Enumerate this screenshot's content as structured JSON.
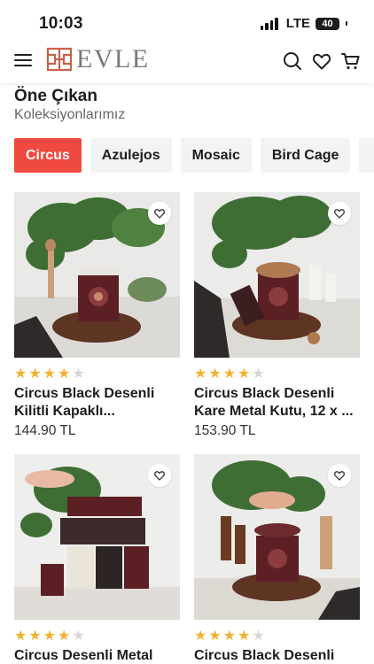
{
  "status_bar": {
    "time": "10:03",
    "network": "LTE",
    "battery": "40"
  },
  "header": {
    "logo_text": "EVLE",
    "brand_color": "#c8614a",
    "icons": [
      "menu-icon",
      "search-icon",
      "heart-icon",
      "cart-icon"
    ]
  },
  "section": {
    "title": "Öne Çıkan",
    "subtitle": "Koleksiyonlarımız"
  },
  "tabs": [
    {
      "label": "Circus",
      "active": true
    },
    {
      "label": "Azulejos",
      "active": false
    },
    {
      "label": "Mosaic",
      "active": false
    },
    {
      "label": "Bird Cage",
      "active": false
    }
  ],
  "accent_color": "#f0493f",
  "products": [
    {
      "name_line1": "Circus Black Desenli",
      "name_line2": "Kilitli Kapaklı...",
      "price": "144.90 TL",
      "rating": 4
    },
    {
      "name_line1": "Circus Black Desenli",
      "name_line2": "Kare Metal Kutu, 12 x ...",
      "price": "153.90 TL",
      "rating": 4
    },
    {
      "name_line1": "Circus Desenli Metal",
      "name_line2": "",
      "price": "",
      "rating": 4
    },
    {
      "name_line1": "Circus Black Desenli",
      "name_line2": "",
      "price": "",
      "rating": 4
    }
  ]
}
